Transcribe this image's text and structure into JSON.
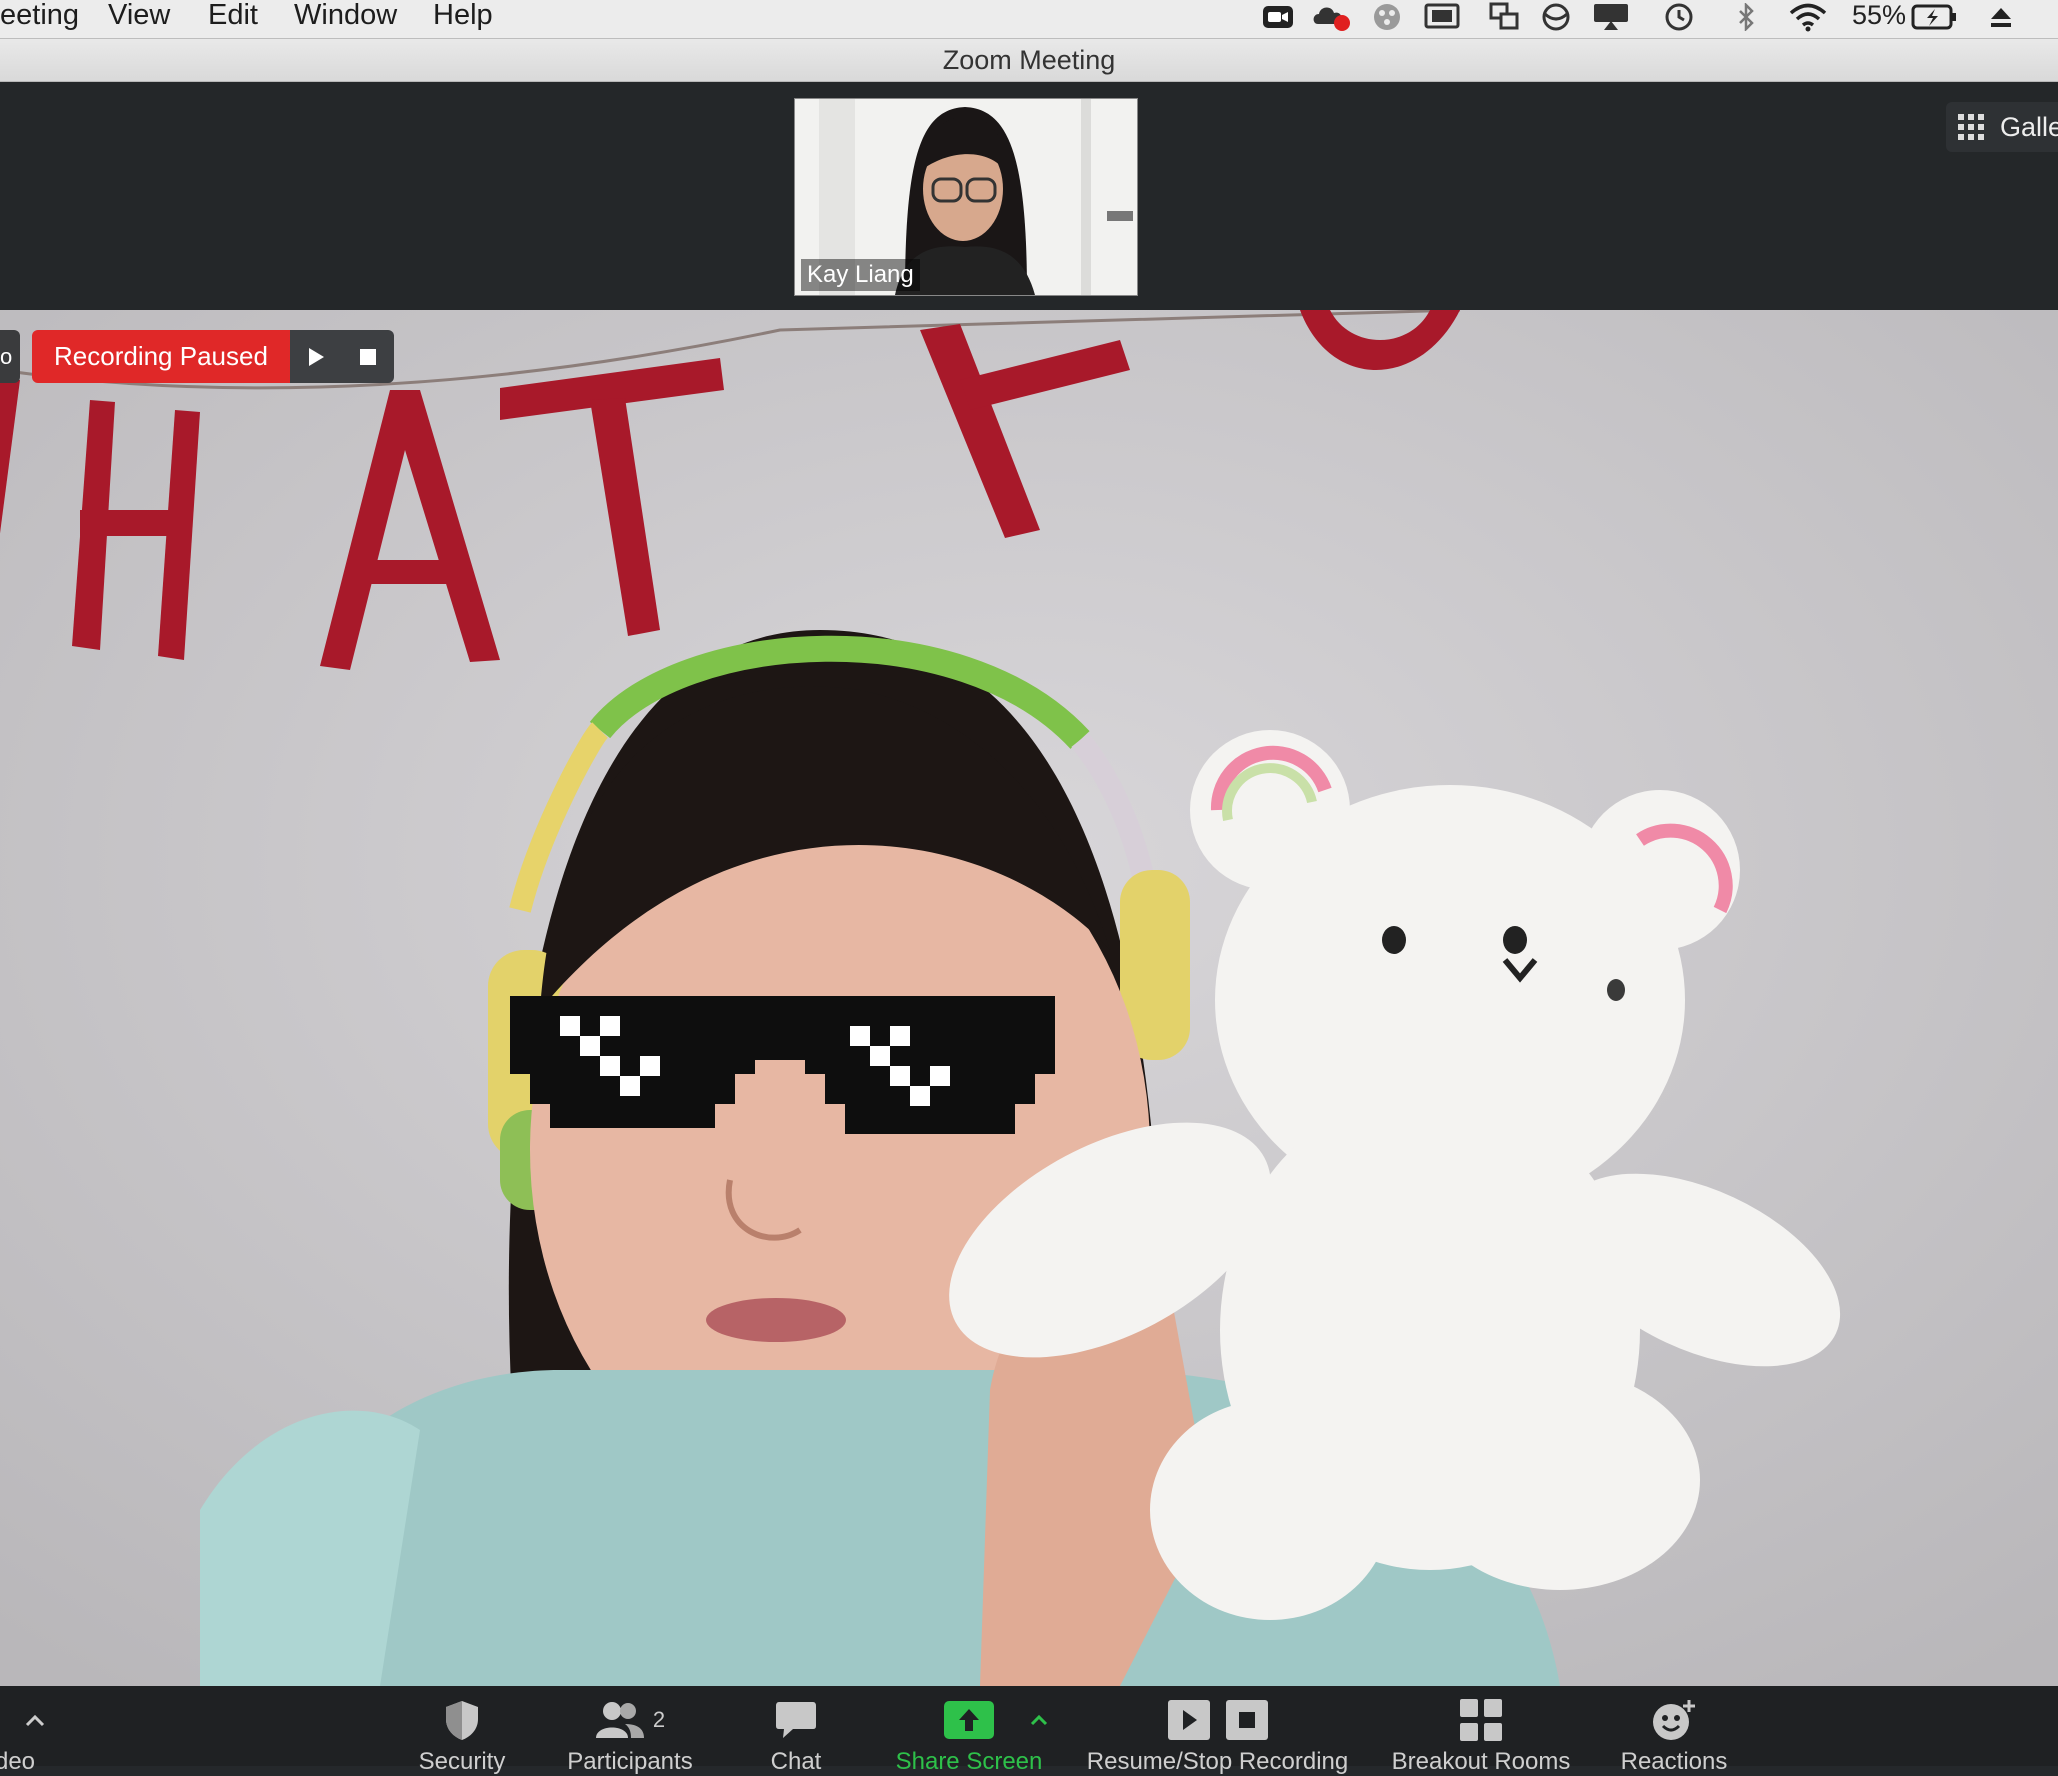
{
  "menubar": {
    "items": [
      "eeting",
      "View",
      "Edit",
      "Window",
      "Help"
    ],
    "battery": "55%"
  },
  "window": {
    "title": "Zoom Meeting"
  },
  "thumbnail": {
    "name": "Kay Liang"
  },
  "view_switch": {
    "label": "Galle"
  },
  "recording": {
    "status": "Recording Paused",
    "left_stub": "o"
  },
  "toolbar": {
    "left_label": "deo",
    "security": "Security",
    "participants": "Participants",
    "participants_count": "2",
    "chat": "Chat",
    "share": "Share Screen",
    "record": "Resume/Stop Recording",
    "breakout": "Breakout Rooms",
    "reactions": "Reactions"
  },
  "colors": {
    "recording_red": "#e02828",
    "share_green": "#2ec14a",
    "toolbar_bg": "#1f2123"
  },
  "icons": [
    "zoom-icon",
    "creative-cloud-icon",
    "extension-icon",
    "display-icon",
    "screen-share-icon",
    "circle-icon",
    "airplay-icon",
    "time-machine-icon",
    "bluetooth-icon",
    "wifi-icon",
    "battery-icon",
    "eject-icon",
    "grid-icon",
    "shield-icon",
    "people-icon",
    "chat-bubble-icon",
    "share-arrow-icon",
    "caret-up-icon",
    "play-icon",
    "stop-icon",
    "breakout-icon",
    "smiley-plus-icon"
  ]
}
